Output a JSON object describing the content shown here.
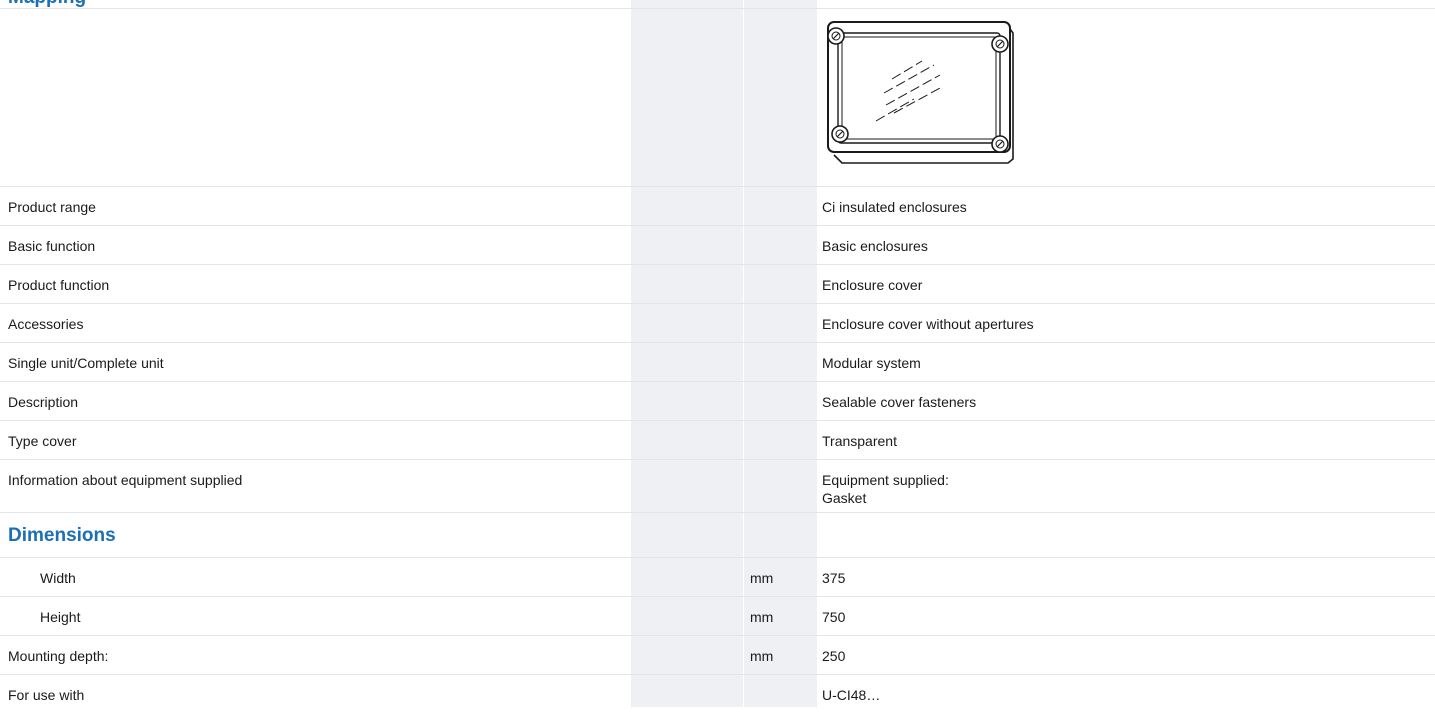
{
  "heading": "Mapping",
  "rows": [
    {
      "label": "Product range",
      "unit": "",
      "value": "Ci insulated enclosures"
    },
    {
      "label": "Basic function",
      "unit": "",
      "value": "Basic enclosures"
    },
    {
      "label": "Product function",
      "unit": "",
      "value": "Enclosure cover"
    },
    {
      "label": "Accessories",
      "unit": "",
      "value": "Enclosure cover without apertures"
    },
    {
      "label": "Single unit/Complete unit",
      "unit": "",
      "value": "Modular system"
    },
    {
      "label": "Description",
      "unit": "",
      "value": "Sealable cover fasteners"
    },
    {
      "label": "Type cover",
      "unit": "",
      "value": "Transparent"
    },
    {
      "label": "Information about equipment supplied",
      "unit": "",
      "value_line1": "Equipment supplied:",
      "value_line2": "Gasket"
    }
  ],
  "dimensions": {
    "title": "Dimensions",
    "rows": [
      {
        "label": "Width",
        "unit": "mm",
        "value": "375"
      },
      {
        "label": "Height",
        "unit": "mm",
        "value": "750"
      }
    ]
  },
  "extra_rows": [
    {
      "label": "Mounting depth:",
      "unit": "mm",
      "value": "250"
    },
    {
      "label": "For use with",
      "unit": "",
      "value": "U-CI48…"
    }
  ],
  "image": {
    "icon": "enclosure-cover-icon"
  }
}
